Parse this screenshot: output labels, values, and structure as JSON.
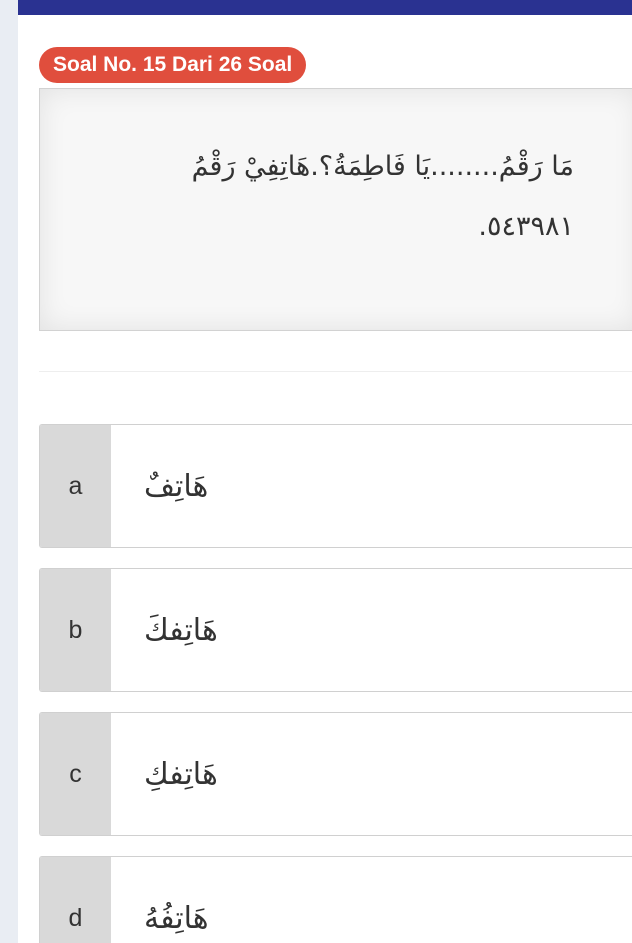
{
  "header": {
    "soal_label": "Soal No. 15 Dari 26 Soal"
  },
  "question": {
    "text": "مَا رَقْمُ........يَا فَاطِمَةُ؟.هَاتِفِيْ رَقْمُ ٥٤٣٩٨١."
  },
  "options": [
    {
      "letter": "a",
      "text": "هَاتِفٌ"
    },
    {
      "letter": "b",
      "text": "هَاتِفكَ"
    },
    {
      "letter": "c",
      "text": "هَاتِفكِ"
    },
    {
      "letter": "d",
      "text": "هَاتِفُهُ"
    }
  ],
  "colors": {
    "top_bar": "#2a3291",
    "badge": "#e04e3d",
    "letter_cell": "#d9d9d9",
    "left_rail": "#e9edf3"
  }
}
